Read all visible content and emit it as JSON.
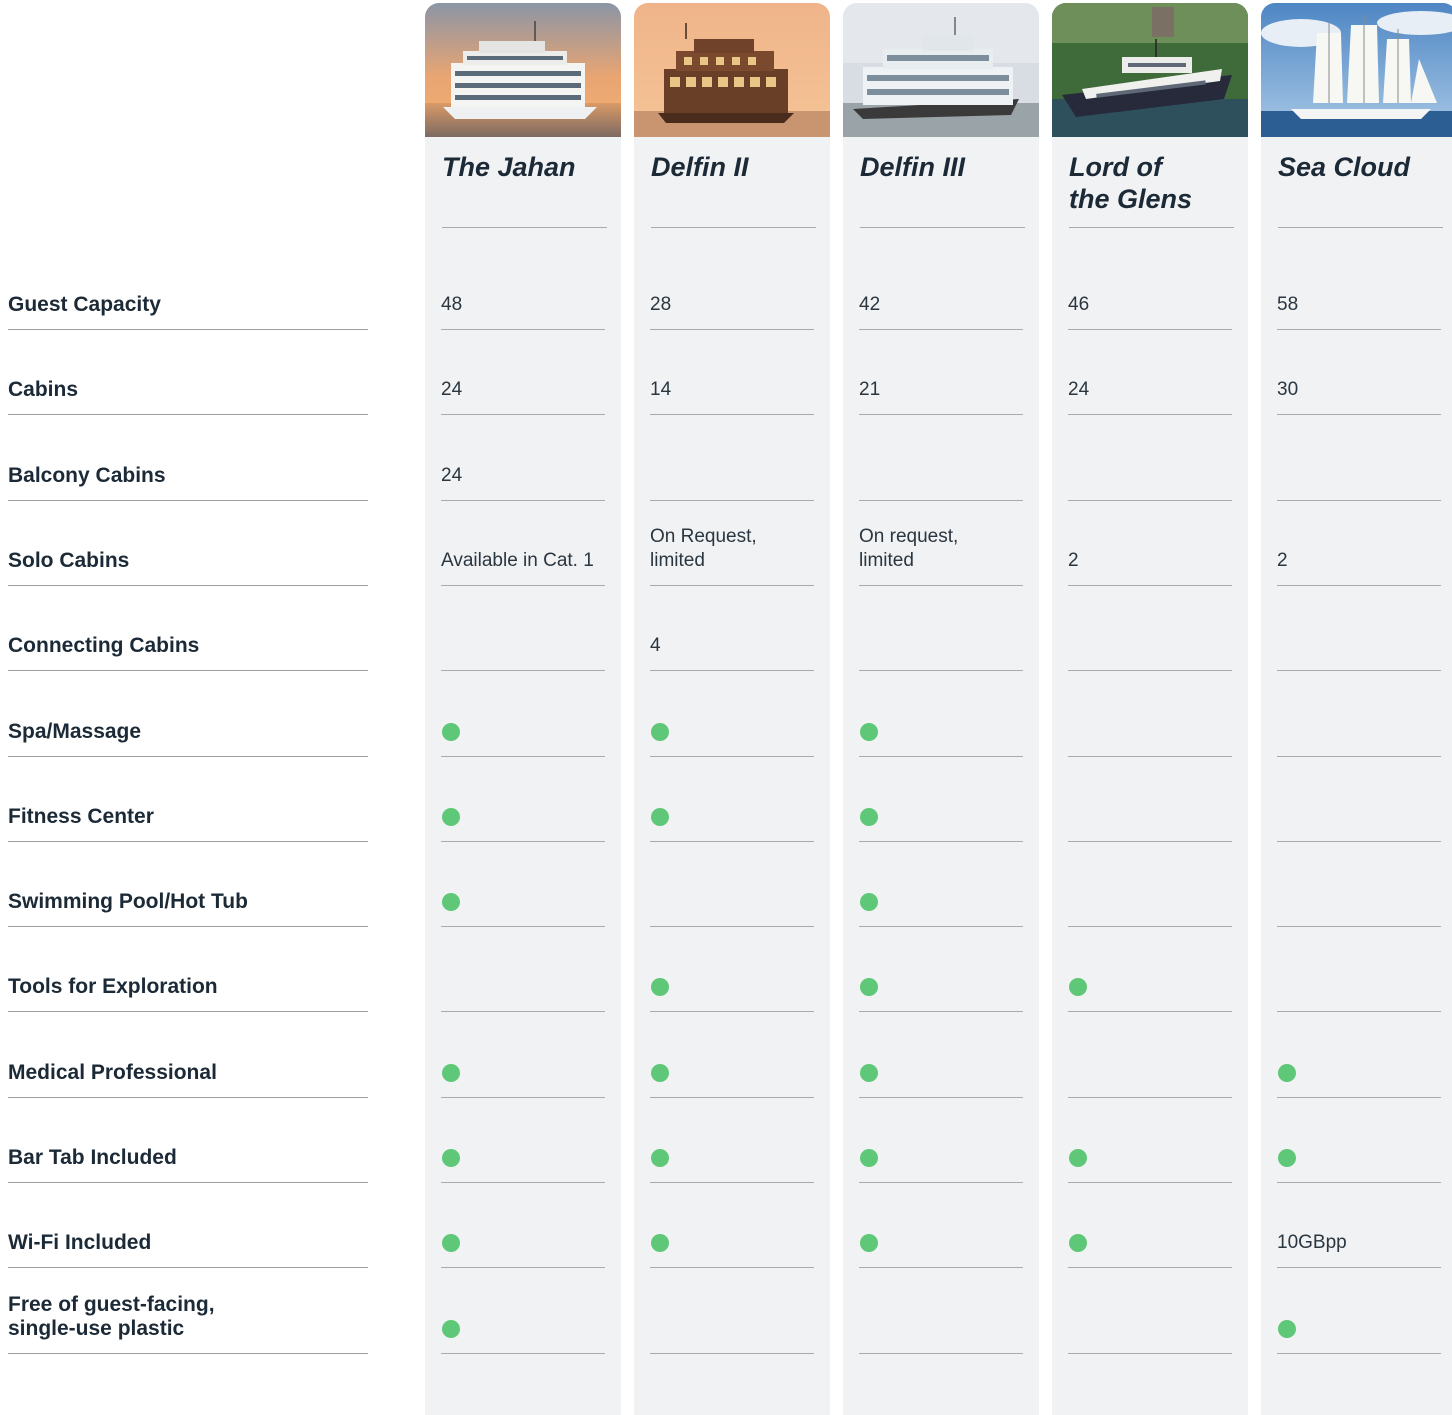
{
  "rows": [
    "Guest Capacity",
    "Cabins",
    "Balcony Cabins",
    "Solo Cabins",
    "Connecting Cabins",
    "Spa/Massage",
    "Fitness Center",
    "Swimming Pool/Hot Tub",
    "Tools for Exploration",
    "Medical Professional",
    "Bar Tab Included",
    "Wi-Fi Included",
    "Free of guest-facing,\nsingle-use plastic"
  ],
  "ships": [
    {
      "name": "The Jahan",
      "photo": "ship-jahan-photo",
      "values": [
        "48",
        "24",
        "24",
        "Available in Cat. 1",
        "",
        "●",
        "●",
        "●",
        "",
        "●",
        "●",
        "●",
        "●"
      ]
    },
    {
      "name": "Delfin II",
      "photo": "ship-delfin-ii-photo",
      "values": [
        "28",
        "14",
        "",
        "On Request,\nlimited",
        "4",
        "●",
        "●",
        "",
        "●",
        "●",
        "●",
        "●",
        ""
      ]
    },
    {
      "name": "Delfin III",
      "photo": "ship-delfin-iii-photo",
      "values": [
        "42",
        "21",
        "",
        "On request,\nlimited",
        "",
        "●",
        "●",
        "●",
        "●",
        "●",
        "●",
        "●",
        ""
      ]
    },
    {
      "name": "Lord of\nthe Glens",
      "photo": "ship-lord-of-the-glens-photo",
      "values": [
        "46",
        "24",
        "",
        "2",
        "",
        "",
        "",
        "",
        "●",
        "",
        "●",
        "●",
        ""
      ]
    },
    {
      "name": "Sea Cloud",
      "photo": "ship-sea-cloud-photo",
      "values": [
        "58",
        "30",
        "",
        "2",
        "",
        "",
        "",
        "",
        "",
        "●",
        "●",
        "10GBpp",
        "●"
      ]
    }
  ],
  "included_marker_color": "#5fc878"
}
